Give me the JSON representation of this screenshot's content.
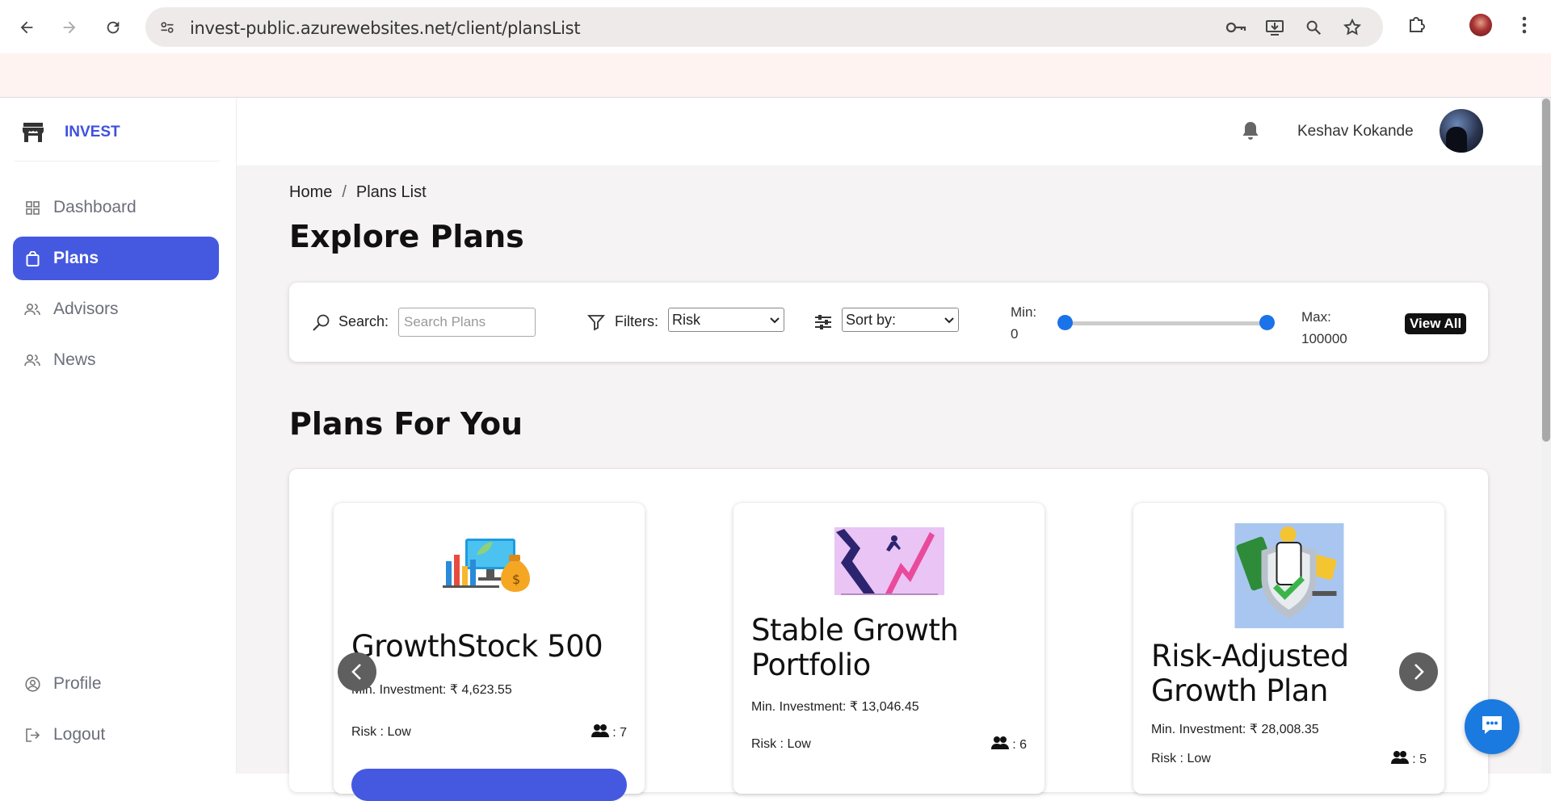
{
  "browser": {
    "url": "invest-public.azurewebsites.net/client/plansList"
  },
  "sidebar": {
    "brand": "INVEST",
    "items": [
      {
        "label": "Dashboard",
        "icon": "grid-icon",
        "active": false
      },
      {
        "label": "Plans",
        "icon": "bag-icon",
        "active": true
      },
      {
        "label": "Advisors",
        "icon": "people-icon",
        "active": false
      },
      {
        "label": "News",
        "icon": "people-icon",
        "active": false
      }
    ],
    "bottom": [
      {
        "label": "Profile",
        "icon": "user-circle-icon"
      },
      {
        "label": "Logout",
        "icon": "logout-icon"
      }
    ]
  },
  "header": {
    "user_name": "Keshav Kokande"
  },
  "breadcrumb": {
    "home": "Home",
    "separator": "/",
    "current": "Plans List"
  },
  "page_title": "Explore Plans",
  "filters": {
    "search_label": "Search:",
    "search_placeholder": "Search Plans",
    "filters_label": "Filters:",
    "filter_value": "Risk",
    "sort_value": "Sort by:",
    "min_label": "Min:",
    "min_value": "0",
    "max_label": "Max:",
    "max_value": "100000",
    "view_all": "View All",
    "accent": "#1a73e8"
  },
  "section_title": "Plans For You",
  "plans": [
    {
      "title": "GrowthStock 500",
      "min_investment": "Min. Investment: ₹ 4,623.55",
      "risk": "Risk : Low",
      "members": ": 7"
    },
    {
      "title": "Stable Growth Portfolio",
      "min_investment": "Min. Investment: ₹ 13,046.45",
      "risk": "Risk : Low",
      "members": ": 6"
    },
    {
      "title": "Risk-Adjusted Growth Plan",
      "min_investment": "Min. Investment: ₹ 28,008.35",
      "risk": "Risk : Low",
      "members": ": 5"
    }
  ],
  "colors": {
    "primary": "#4559e0",
    "brand": "#3f51e0"
  }
}
